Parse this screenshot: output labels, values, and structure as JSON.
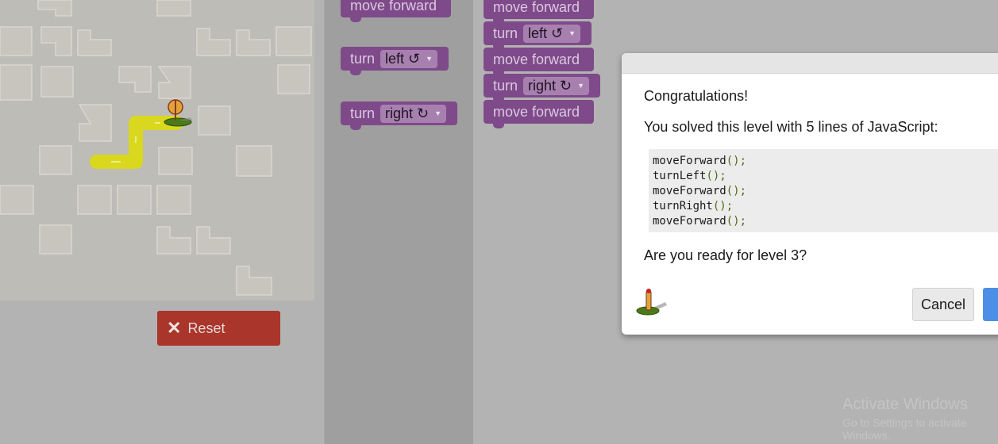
{
  "maze": {
    "reset_label": "Reset"
  },
  "toolbox": {
    "blocks": [
      {
        "label": "move forward"
      },
      {
        "label": "turn",
        "option": "left ↺"
      },
      {
        "label": "turn",
        "option": "right ↻"
      }
    ]
  },
  "workspace": {
    "blocks": [
      {
        "label": "move forward"
      },
      {
        "label": "turn",
        "option": "left ↺"
      },
      {
        "label": "move forward"
      },
      {
        "label": "turn",
        "option": "right ↻"
      },
      {
        "label": "move forward"
      }
    ]
  },
  "dialog": {
    "congrats": "Congratulations!",
    "solved": "You solved this level with 5 lines of JavaScript:",
    "code_lines": [
      {
        "fn": "moveForward",
        "args": "();"
      },
      {
        "fn": "turnLeft",
        "args": "();"
      },
      {
        "fn": "moveForward",
        "args": "();"
      },
      {
        "fn": "turnRight",
        "args": "();"
      },
      {
        "fn": "moveForward",
        "args": "();"
      }
    ],
    "prompt": "Are you ready for level 3?",
    "cancel_label": "Cancel"
  },
  "watermark": {
    "title": "Activate Windows",
    "subtitle": "Go to Settings to activate Windows."
  },
  "colors": {
    "block": "#7e4a8a",
    "reset": "#a9352b",
    "ok": "#4d8fe6",
    "path": "#d9d81e"
  }
}
